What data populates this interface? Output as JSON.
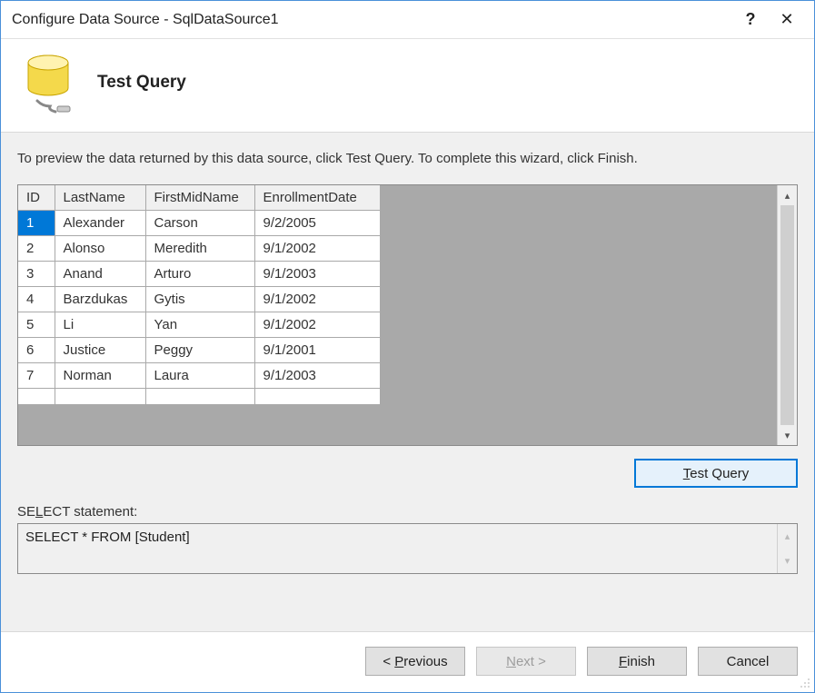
{
  "window": {
    "title": "Configure Data Source - SqlDataSource1"
  },
  "header": {
    "title": "Test Query"
  },
  "instruction": "To preview the data returned by this data source, click Test Query. To complete this wizard, click Finish.",
  "grid": {
    "columns": [
      "ID",
      "LastName",
      "FirstMidName",
      "EnrollmentDate"
    ],
    "rows": [
      {
        "ID": "1",
        "LastName": "Alexander",
        "FirstMidName": "Carson",
        "EnrollmentDate": "9/2/2005"
      },
      {
        "ID": "2",
        "LastName": "Alonso",
        "FirstMidName": "Meredith",
        "EnrollmentDate": "9/1/2002"
      },
      {
        "ID": "3",
        "LastName": "Anand",
        "FirstMidName": "Arturo",
        "EnrollmentDate": "9/1/2003"
      },
      {
        "ID": "4",
        "LastName": "Barzdukas",
        "FirstMidName": "Gytis",
        "EnrollmentDate": "9/1/2002"
      },
      {
        "ID": "5",
        "LastName": "Li",
        "FirstMidName": "Yan",
        "EnrollmentDate": "9/1/2002"
      },
      {
        "ID": "6",
        "LastName": "Justice",
        "FirstMidName": "Peggy",
        "EnrollmentDate": "9/1/2001"
      },
      {
        "ID": "7",
        "LastName": "Norman",
        "FirstMidName": "Laura",
        "EnrollmentDate": "9/1/2003"
      }
    ],
    "selected_row_index": 0
  },
  "buttons": {
    "test_query": "Test Query",
    "previous_full": "< Previous",
    "previous_prefix": "< ",
    "previous_ul": "P",
    "previous_rest": "revious",
    "next_ul": "N",
    "next_rest": "ext >",
    "finish_ul": "F",
    "finish_rest": "inish",
    "cancel": "Cancel"
  },
  "select_stmt": {
    "label_prefix": "SE",
    "label_ul": "L",
    "label_rest": "ECT statement:",
    "value": "SELECT * FROM [Student]"
  }
}
